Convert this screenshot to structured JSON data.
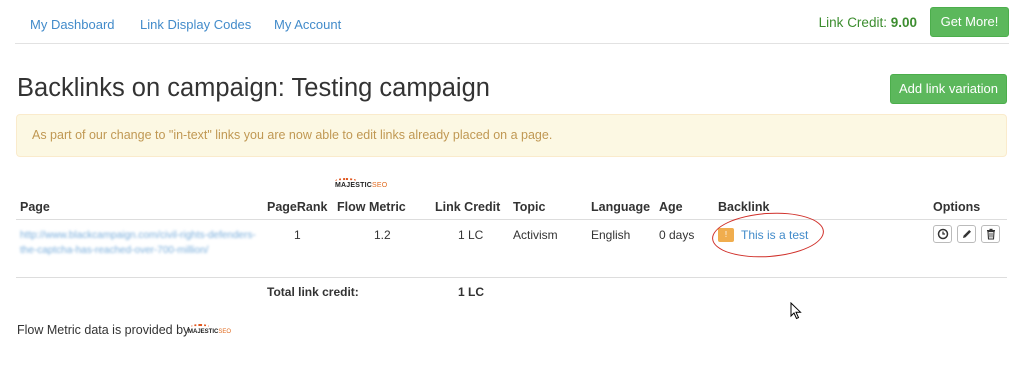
{
  "nav": {
    "links": [
      "My Dashboard",
      "Link Display Codes",
      "My Account"
    ],
    "credit_label": "Link Credit:",
    "credit_value": "9.00",
    "get_more": "Get More!"
  },
  "page": {
    "title": "Backlinks on campaign: Testing campaign",
    "add_variation": "Add link variation",
    "alert": "As part of our change to \"in-text\" links you are now able to edit links already placed on a page."
  },
  "table": {
    "majestic_logo": "MAJESTIC",
    "majestic_logo_suffix": "SEO",
    "headers": [
      "Page",
      "PageRank",
      "Flow Metric",
      "Link Credit",
      "Topic",
      "Language",
      "Age",
      "Backlink",
      "Options"
    ],
    "row": {
      "page": "http://www.blackcampaign.com/civil-rights-defenders-the-captcha-has-reached-over-700-million/",
      "pagerank": "1",
      "flow_metric": "1.2",
      "link_credit": "1 LC",
      "topic": "Activism",
      "language": "English",
      "age": "0 days",
      "backlink_badge": "!",
      "backlink_text": "This is a test"
    },
    "total_label": "Total link credit:",
    "total_value": "1 LC"
  },
  "footer": {
    "text": "Flow Metric data is provided by",
    "logo": "MAJESTIC",
    "logo_suffix": "SEO"
  },
  "colors": {
    "link": "#428bca",
    "green_button": "#5cb85c",
    "alert_bg": "#fcf8e3",
    "alert_text": "#c09853",
    "annotation_circle": "#d0302a"
  }
}
